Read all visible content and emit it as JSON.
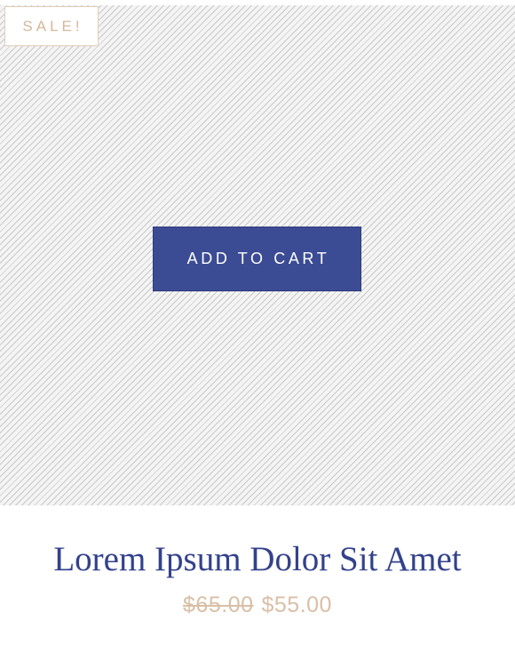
{
  "badge": {
    "label": "SALE!"
  },
  "actions": {
    "add_to_cart_label": "ADD TO CART"
  },
  "product": {
    "title": "Lorem Ipsum Dolor Sit Amet",
    "old_price": "$65.00",
    "price": "$55.00"
  },
  "colors": {
    "accent": "#3b4b94",
    "title": "#33428c",
    "price": "#d9bfa6",
    "badge_border": "#e3cdb8"
  }
}
